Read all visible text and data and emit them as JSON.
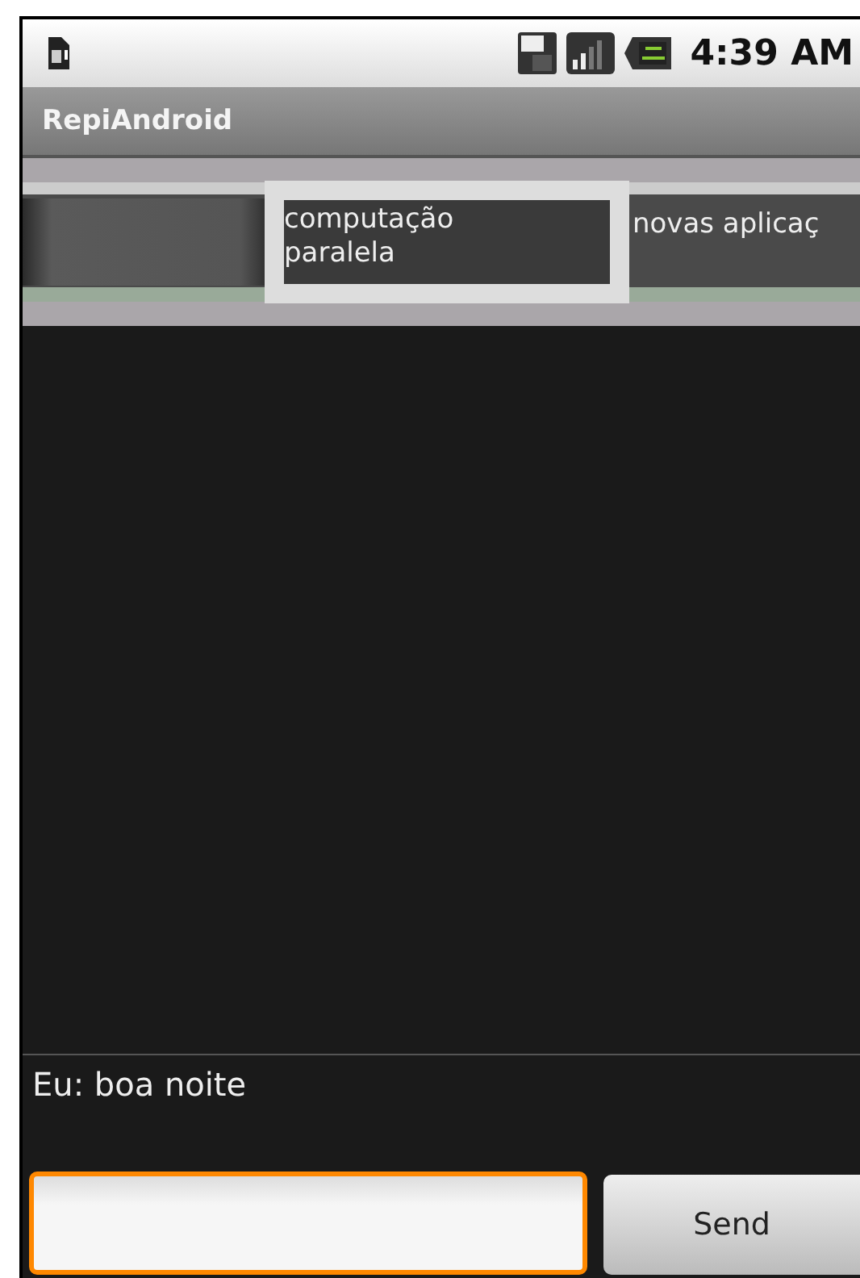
{
  "status_bar": {
    "time": "4:39 AM"
  },
  "title_bar": {
    "title": "RepiAndroid"
  },
  "gallery": {
    "items": [
      {
        "selected": false
      },
      {
        "label": "computação paralela",
        "selected": true
      },
      {
        "label": "novas aplicaç",
        "selected": false
      }
    ]
  },
  "messages": [
    "Eu: boa noite"
  ],
  "composer": {
    "send_label": "Send"
  }
}
